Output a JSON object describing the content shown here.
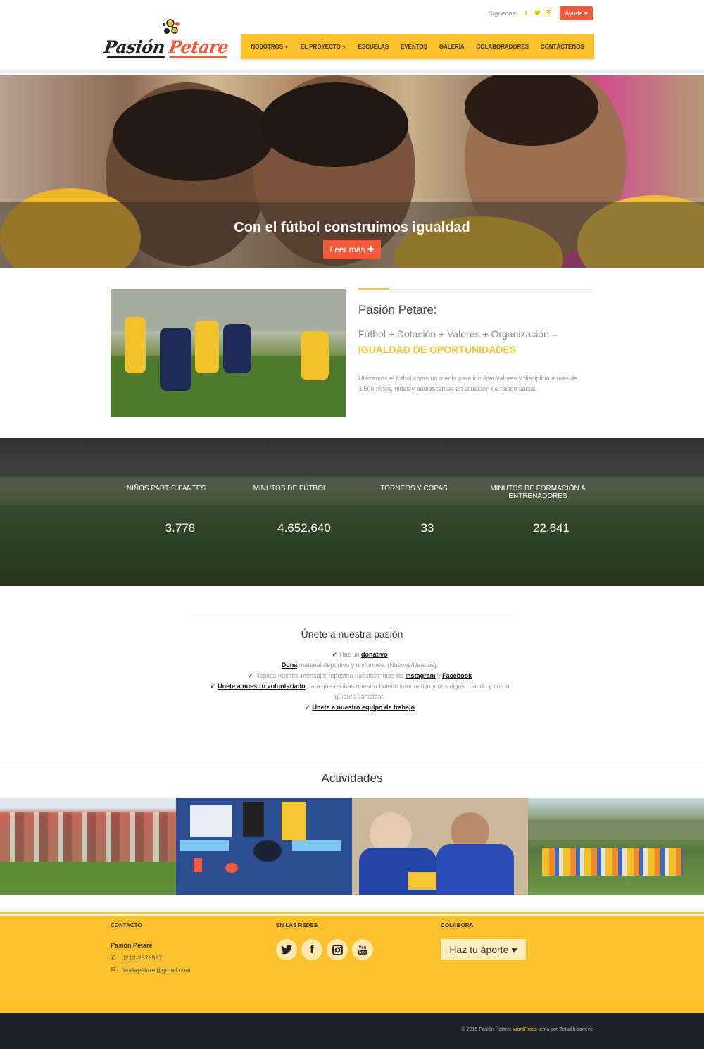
{
  "header": {
    "follow_label": "Síguenos:",
    "social_icons": [
      "facebook-icon",
      "twitter-icon",
      "instagram-icon"
    ],
    "help_button": "Ayuda",
    "logo_text_1": "Pasión",
    "logo_text_2": "Petare"
  },
  "nav": {
    "items": [
      {
        "label": "NOSOTROS",
        "dropdown": true
      },
      {
        "label": "EL PROYECTO",
        "dropdown": true
      },
      {
        "label": "ESCUELAS",
        "dropdown": false
      },
      {
        "label": "EVENTOS",
        "dropdown": false
      },
      {
        "label": "GALERÍA",
        "dropdown": false
      },
      {
        "label": "COLABORADORES",
        "dropdown": false
      },
      {
        "label": "CONTÁCTENOS",
        "dropdown": false
      }
    ]
  },
  "hero": {
    "title": "Con el fútbol construimos igualdad",
    "button": "Leer más"
  },
  "about": {
    "title": "Pasión Petare:",
    "formula": "Fútbol + Dotación + Valores + Organización =",
    "highlight": "IGUALDAD DE OPORTUNIDADES",
    "description": "Utilizamos el fútbol como un medio para inculcar valores y disciplina a más de 3.500 niños, niñas y adolescentes en situación de riesgo social."
  },
  "stats": [
    {
      "label": "NIÑOS PARTICIPANTES",
      "value": "3.778"
    },
    {
      "label": "MINUTOS DE FÚTBOL",
      "value": "4.652.640"
    },
    {
      "label": "TORNEOS Y COPAS",
      "value": "33"
    },
    {
      "label": "MINUTOS DE FORMACIÓN A ENTRENADORES",
      "value": "22.641"
    }
  ],
  "join": {
    "title": "Únete a nuestra pasión",
    "line1_pre": "Haz un",
    "line1_link": "donativo",
    "line2_link": "Dona",
    "line2_post": "material deportivo y uniformes. (Nuevos/Usados).",
    "line3_pre": "Replica nuestro mensaje: repostea nuestras fotos de",
    "line3_link1": "Instagram",
    "line3_mid": "y",
    "line3_link2": "Facebook",
    "line4_link": "Únete a nuestro voluntariado",
    "line4_post": "para que recibas nuestro boletín informativo y nos digas cuándo y cómo quieres participar.",
    "line5_link": "Únete a nuestro equipo de trabajo"
  },
  "activities": {
    "title": "Actividades"
  },
  "footer": {
    "contact_head": "CONTACTO",
    "social_head": "EN LAS REDES",
    "collab_head": "COLABORA",
    "org_name": "Pasión Petare",
    "phone": "0212-2578567",
    "email": "fundapetare@gmail.com",
    "social_icons": [
      "twitter-icon",
      "facebook-icon",
      "instagram-icon",
      "youtube-icon"
    ],
    "donate_button": "Haz tu áporte",
    "copyright_pre": "© 2015 Pasión Petare.",
    "copyright_wp": "WordPress",
    "copyright_post": "tema por Zetadib.com.ve"
  },
  "colors": {
    "accent_yellow": "#fbc22d",
    "accent_red": "#f15a3b",
    "footer_dark": "#1f2228"
  }
}
